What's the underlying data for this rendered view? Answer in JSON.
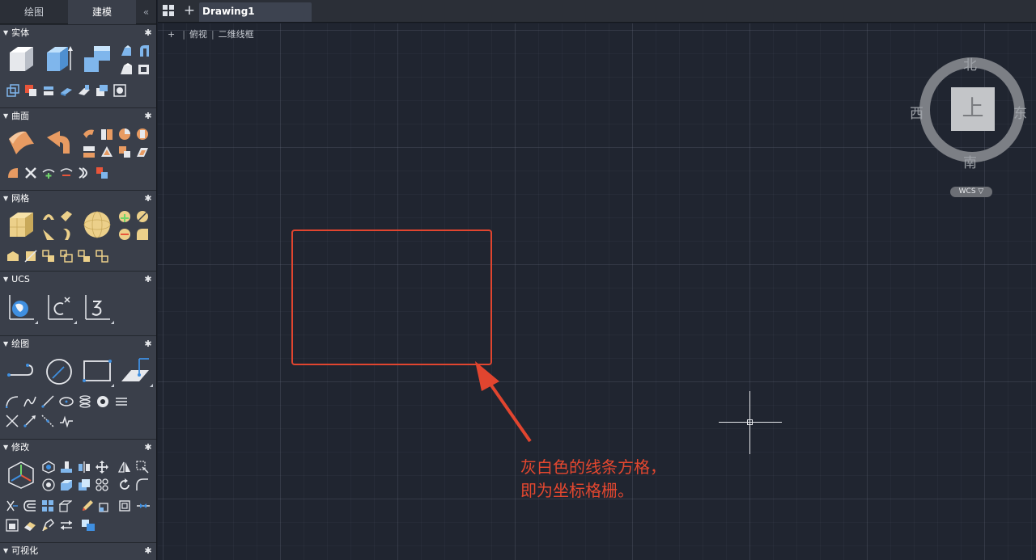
{
  "palette": {
    "tabs": [
      {
        "label": "绘图"
      },
      {
        "label": "建模"
      }
    ],
    "collapse_glyph": "«",
    "sections": [
      {
        "title": "实体"
      },
      {
        "title": "曲面"
      },
      {
        "title": "网格"
      },
      {
        "title": "UCS"
      },
      {
        "title": "绘图"
      },
      {
        "title": "修改"
      },
      {
        "title": "可视化"
      }
    ]
  },
  "doc_tabs": {
    "new_tab_glyph": "+",
    "active": "Drawing1"
  },
  "viewport": {
    "controls": {
      "menu": "+",
      "view": "俯视",
      "visual_style": "二维线框"
    }
  },
  "viewcube": {
    "face": "上",
    "north": "北",
    "south": "南",
    "west": "西",
    "east": "东",
    "wcs_label": "WCS ▽"
  },
  "annotation": {
    "line1": "灰白色的线条方格，",
    "line2": "即为坐标格栅。"
  },
  "colors": {
    "canvas_bg": "#202530",
    "palette_bg": "#3a3f4a",
    "annotation_red": "#e1452f",
    "tool_blue": "#7fb6ec",
    "tool_orange": "#e89b62",
    "tool_yellow": "#ecd08a"
  },
  "icons": {
    "section_toggle": "triangle-down-icon",
    "section_settings": "gear-icon",
    "window_layout": "grid-icon",
    "cursor": "crosshair-icon"
  }
}
